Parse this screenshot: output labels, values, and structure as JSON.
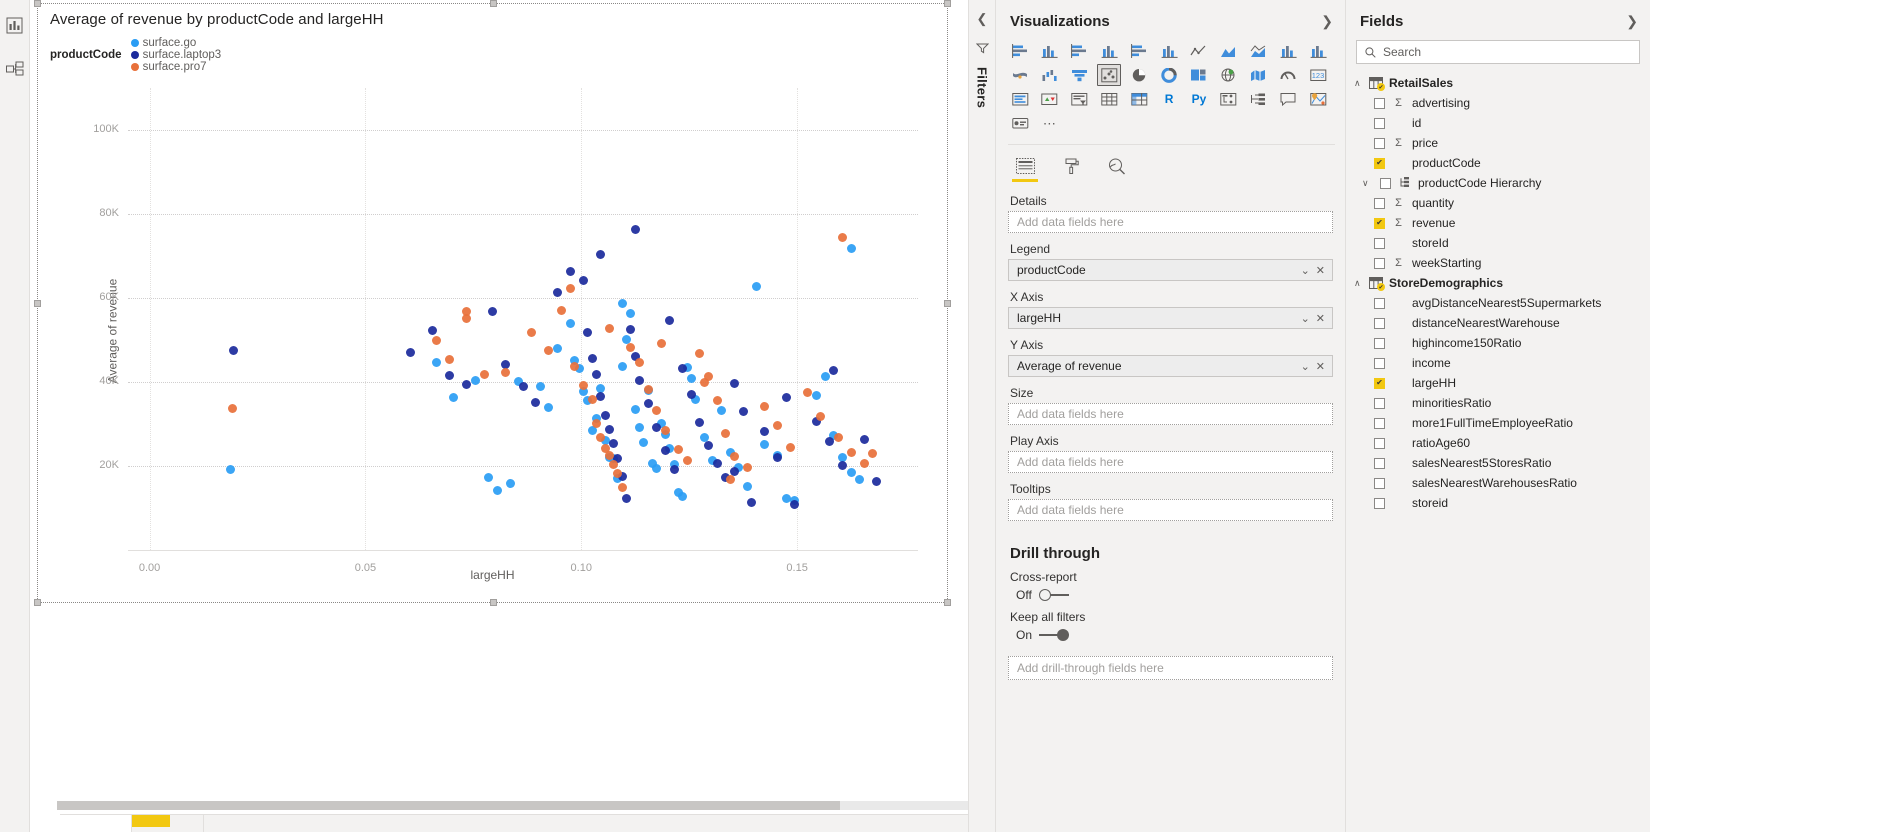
{
  "left_rail": [
    {
      "name": "report-view",
      "icon": "bar-chart-icon"
    },
    {
      "name": "model-view",
      "icon": "model-relationships-icon"
    }
  ],
  "visual": {
    "title": "Average of revenue by productCode and largeHH",
    "legend_title": "productCode",
    "legend": [
      {
        "label": "surface.go",
        "color": "#2a9df4"
      },
      {
        "label": "surface.laptop3",
        "color": "#1b2a9c"
      },
      {
        "label": "surface.pro7",
        "color": "#e8703a"
      }
    ]
  },
  "chart_data": {
    "type": "scatter",
    "title": "Average of revenue by productCode and largeHH",
    "xlabel": "largeHH",
    "ylabel": "Average of revenue",
    "xlim": [
      -0.005,
      0.178
    ],
    "ylim": [
      0,
      110000
    ],
    "xticks": [
      0.0,
      0.05,
      0.1,
      0.15
    ],
    "xtick_labels": [
      "0.00",
      "0.05",
      "0.10",
      "0.15"
    ],
    "yticks": [
      20000,
      40000,
      60000,
      80000,
      100000
    ],
    "ytick_labels": [
      "20K",
      "40K",
      "60K",
      "80K",
      "100K"
    ],
    "grid": true,
    "legend_position": "top-left",
    "series": [
      {
        "name": "surface.go",
        "color": "#2a9df4",
        "points": [
          [
            0.0188,
            19200
          ],
          [
            0.0755,
            40300
          ],
          [
            0.0855,
            40200
          ],
          [
            0.0905,
            39000
          ],
          [
            0.0945,
            47900
          ],
          [
            0.0975,
            54000
          ],
          [
            0.0985,
            45200
          ],
          [
            0.0995,
            43300
          ],
          [
            0.1005,
            37800
          ],
          [
            0.1015,
            35600
          ],
          [
            0.1025,
            28400
          ],
          [
            0.1035,
            31200
          ],
          [
            0.1045,
            38400
          ],
          [
            0.1055,
            26100
          ],
          [
            0.1065,
            22100
          ],
          [
            0.1075,
            21700
          ],
          [
            0.1085,
            17100
          ],
          [
            0.1095,
            43800
          ],
          [
            0.1105,
            50100
          ],
          [
            0.1115,
            56400
          ],
          [
            0.1125,
            33400
          ],
          [
            0.1135,
            29100
          ],
          [
            0.1145,
            25600
          ],
          [
            0.1155,
            37900
          ],
          [
            0.1165,
            20500
          ],
          [
            0.1175,
            19400
          ],
          [
            0.1185,
            30100
          ],
          [
            0.1195,
            27600
          ],
          [
            0.1205,
            24200
          ],
          [
            0.1215,
            20300
          ],
          [
            0.1225,
            13700
          ],
          [
            0.1235,
            12800
          ],
          [
            0.1245,
            43500
          ],
          [
            0.1255,
            40900
          ],
          [
            0.1265,
            35900
          ],
          [
            0.1285,
            26900
          ],
          [
            0.1305,
            21200
          ],
          [
            0.1325,
            33200
          ],
          [
            0.1345,
            23200
          ],
          [
            0.1365,
            19700
          ],
          [
            0.1385,
            15200
          ],
          [
            0.1405,
            62700
          ],
          [
            0.1425,
            25100
          ],
          [
            0.1455,
            22400
          ],
          [
            0.1475,
            12300
          ],
          [
            0.1495,
            11900
          ],
          [
            0.1545,
            36700
          ],
          [
            0.1565,
            41200
          ],
          [
            0.1585,
            27300
          ],
          [
            0.1605,
            22100
          ],
          [
            0.1625,
            18400
          ],
          [
            0.1645,
            16900
          ],
          [
            0.0835,
            15900
          ],
          [
            0.0805,
            14100
          ],
          [
            0.0785,
            17300
          ],
          [
            0.0925,
            33900
          ],
          [
            0.1625,
            71800
          ],
          [
            0.1095,
            58600
          ],
          [
            0.0665,
            44700
          ],
          [
            0.0705,
            36300
          ]
        ]
      },
      {
        "name": "surface.laptop3",
        "color": "#1b2a9c",
        "points": [
          [
            0.0195,
            47600
          ],
          [
            0.0945,
            61200
          ],
          [
            0.0975,
            66300
          ],
          [
            0.1005,
            64100
          ],
          [
            0.1015,
            51900
          ],
          [
            0.1025,
            45600
          ],
          [
            0.1035,
            41700
          ],
          [
            0.1045,
            36500
          ],
          [
            0.1055,
            32100
          ],
          [
            0.1065,
            28700
          ],
          [
            0.1075,
            25300
          ],
          [
            0.1085,
            21900
          ],
          [
            0.1095,
            17600
          ],
          [
            0.1105,
            12200
          ],
          [
            0.1115,
            52400
          ],
          [
            0.1125,
            46100
          ],
          [
            0.1135,
            40300
          ],
          [
            0.1155,
            34800
          ],
          [
            0.1175,
            29200
          ],
          [
            0.1195,
            23700
          ],
          [
            0.1215,
            19100
          ],
          [
            0.1235,
            43200
          ],
          [
            0.1255,
            37100
          ],
          [
            0.1275,
            30400
          ],
          [
            0.1295,
            24800
          ],
          [
            0.1315,
            20600
          ],
          [
            0.1335,
            17200
          ],
          [
            0.1355,
            39600
          ],
          [
            0.1375,
            32900
          ],
          [
            0.1395,
            11400
          ],
          [
            0.1425,
            28300
          ],
          [
            0.1455,
            22000
          ],
          [
            0.1475,
            36400
          ],
          [
            0.1495,
            10900
          ],
          [
            0.1545,
            30700
          ],
          [
            0.1575,
            25900
          ],
          [
            0.1605,
            20100
          ],
          [
            0.1655,
            26400
          ],
          [
            0.1685,
            16300
          ],
          [
            0.0795,
            56800
          ],
          [
            0.0825,
            44100
          ],
          [
            0.0865,
            38900
          ],
          [
            0.0895,
            35200
          ],
          [
            0.0655,
            52300
          ],
          [
            0.0695,
            41500
          ],
          [
            0.0735,
            39400
          ],
          [
            0.1125,
            76200
          ],
          [
            0.1585,
            42800
          ],
          [
            0.1205,
            54700
          ],
          [
            0.0605,
            47100
          ],
          [
            0.1355,
            18800
          ],
          [
            0.1045,
            70300
          ]
        ]
      },
      {
        "name": "surface.pro7",
        "color": "#e8703a",
        "points": [
          [
            0.0192,
            33800
          ],
          [
            0.0735,
            55100
          ],
          [
            0.0735,
            56900
          ],
          [
            0.0825,
            42300
          ],
          [
            0.0885,
            51700
          ],
          [
            0.0925,
            47400
          ],
          [
            0.0955,
            57100
          ],
          [
            0.0985,
            43800
          ],
          [
            0.1005,
            39100
          ],
          [
            0.1025,
            35800
          ],
          [
            0.1035,
            30200
          ],
          [
            0.1045,
            26700
          ],
          [
            0.1055,
            24100
          ],
          [
            0.1065,
            22600
          ],
          [
            0.1075,
            20300
          ],
          [
            0.1085,
            18100
          ],
          [
            0.1095,
            14900
          ],
          [
            0.1115,
            48300
          ],
          [
            0.1135,
            44600
          ],
          [
            0.1155,
            38200
          ],
          [
            0.1175,
            33100
          ],
          [
            0.1195,
            28400
          ],
          [
            0.1225,
            23900
          ],
          [
            0.1245,
            21300
          ],
          [
            0.1275,
            46800
          ],
          [
            0.1295,
            41200
          ],
          [
            0.1315,
            35700
          ],
          [
            0.1335,
            27800
          ],
          [
            0.1355,
            22300
          ],
          [
            0.1385,
            19600
          ],
          [
            0.1425,
            34100
          ],
          [
            0.1455,
            29700
          ],
          [
            0.1485,
            24500
          ],
          [
            0.1525,
            37600
          ],
          [
            0.1555,
            31900
          ],
          [
            0.1595,
            26800
          ],
          [
            0.1625,
            23100
          ],
          [
            0.1655,
            20700
          ],
          [
            0.1605,
            74300
          ],
          [
            0.1285,
            39900
          ],
          [
            0.0695,
            45300
          ],
          [
            0.0665,
            49800
          ],
          [
            0.0775,
            41800
          ],
          [
            0.1065,
            52800
          ],
          [
            0.0975,
            62300
          ],
          [
            0.1185,
            49200
          ],
          [
            0.1675,
            22900
          ],
          [
            0.1345,
            16800
          ]
        ]
      }
    ]
  },
  "filters_pane": {
    "label": "Filters",
    "collapse_icon": "chevron-left-icon",
    "filter_icon": "filter-funnel-icon"
  },
  "visualizations": {
    "title": "Visualizations",
    "expand_icon": "chevron-right-icon",
    "icons": [
      "stacked-bar-chart-icon",
      "stacked-column-chart-icon",
      "clustered-bar-chart-icon",
      "clustered-column-chart-icon",
      "100-stacked-bar-chart-icon",
      "100-stacked-column-chart-icon",
      "line-chart-icon",
      "area-chart-icon",
      "stacked-area-chart-icon",
      "line-stacked-column-chart-icon",
      "line-clustered-column-chart-icon",
      "ribbon-chart-icon",
      "waterfall-chart-icon",
      "funnel-chart-icon",
      "scatter-chart-icon",
      "pie-chart-icon",
      "donut-chart-icon",
      "treemap-icon",
      "map-icon",
      "filled-map-icon",
      "gauge-icon",
      "card-icon",
      "multi-row-card-icon",
      "kpi-icon",
      "slicer-icon",
      "table-icon",
      "matrix-icon",
      "r-script-visual-icon",
      "py-script-visual-icon",
      "decomposition-tree-icon",
      "key-influencers-icon",
      "q-and-a-icon",
      "arcgis-map-icon",
      "paginated-report-icon",
      "more-options-icon"
    ],
    "selected_icon": "scatter-chart-icon",
    "tabs": [
      {
        "name": "fields-tab",
        "icon": "fields-table-icon",
        "active": true
      },
      {
        "name": "format-tab",
        "icon": "paint-roller-icon",
        "active": false
      },
      {
        "name": "analytics-tab",
        "icon": "analytics-magnifier-icon",
        "active": false
      }
    ],
    "wells": [
      {
        "label": "Details",
        "value": "",
        "placeholder": "Add data fields here",
        "filled": false
      },
      {
        "label": "Legend",
        "value": "productCode",
        "placeholder": "Add data fields here",
        "filled": true
      },
      {
        "label": "X Axis",
        "value": "largeHH",
        "placeholder": "Add data fields here",
        "filled": true
      },
      {
        "label": "Y Axis",
        "value": "Average of revenue",
        "placeholder": "Add data fields here",
        "filled": true
      },
      {
        "label": "Size",
        "value": "",
        "placeholder": "Add data fields here",
        "filled": false
      },
      {
        "label": "Play Axis",
        "value": "",
        "placeholder": "Add data fields here",
        "filled": false
      },
      {
        "label": "Tooltips",
        "value": "",
        "placeholder": "Add data fields here",
        "filled": false
      }
    ],
    "drill_through": {
      "title": "Drill through",
      "cross_report": {
        "label": "Cross-report",
        "state": "Off",
        "on": false
      },
      "keep_all_filters": {
        "label": "Keep all filters",
        "state": "On",
        "on": true
      },
      "drop_placeholder": "Add drill-through fields here"
    }
  },
  "fields": {
    "title": "Fields",
    "expand_icon": "chevron-right-icon",
    "search_placeholder": "Search",
    "search_icon": "search-icon",
    "tables": [
      {
        "name": "RetailSales",
        "expanded": true,
        "fields": [
          {
            "name": "advertising",
            "checked": false,
            "measure": true,
            "hierarchy": false
          },
          {
            "name": "id",
            "checked": false,
            "measure": false,
            "hierarchy": false
          },
          {
            "name": "price",
            "checked": false,
            "measure": true,
            "hierarchy": false
          },
          {
            "name": "productCode",
            "checked": true,
            "measure": false,
            "hierarchy": false
          },
          {
            "name": "productCode Hierarchy",
            "checked": false,
            "measure": false,
            "hierarchy": true
          },
          {
            "name": "quantity",
            "checked": false,
            "measure": true,
            "hierarchy": false
          },
          {
            "name": "revenue",
            "checked": true,
            "measure": true,
            "hierarchy": false
          },
          {
            "name": "storeId",
            "checked": false,
            "measure": false,
            "hierarchy": false
          },
          {
            "name": "weekStarting",
            "checked": false,
            "measure": true,
            "hierarchy": false
          }
        ]
      },
      {
        "name": "StoreDemographics",
        "expanded": true,
        "fields": [
          {
            "name": "avgDistanceNearest5Supermarkets",
            "checked": false,
            "measure": false,
            "hierarchy": false
          },
          {
            "name": "distanceNearestWarehouse",
            "checked": false,
            "measure": false,
            "hierarchy": false
          },
          {
            "name": "highincome150Ratio",
            "checked": false,
            "measure": false,
            "hierarchy": false
          },
          {
            "name": "income",
            "checked": false,
            "measure": false,
            "hierarchy": false
          },
          {
            "name": "largeHH",
            "checked": true,
            "measure": false,
            "hierarchy": false
          },
          {
            "name": "minoritiesRatio",
            "checked": false,
            "measure": false,
            "hierarchy": false
          },
          {
            "name": "more1FullTimeEmployeeRatio",
            "checked": false,
            "measure": false,
            "hierarchy": false
          },
          {
            "name": "ratioAge60",
            "checked": false,
            "measure": false,
            "hierarchy": false
          },
          {
            "name": "salesNearest5StoresRatio",
            "checked": false,
            "measure": false,
            "hierarchy": false
          },
          {
            "name": "salesNearestWarehousesRatio",
            "checked": false,
            "measure": false,
            "hierarchy": false
          },
          {
            "name": "storeid",
            "checked": false,
            "measure": false,
            "hierarchy": false
          }
        ]
      }
    ]
  }
}
